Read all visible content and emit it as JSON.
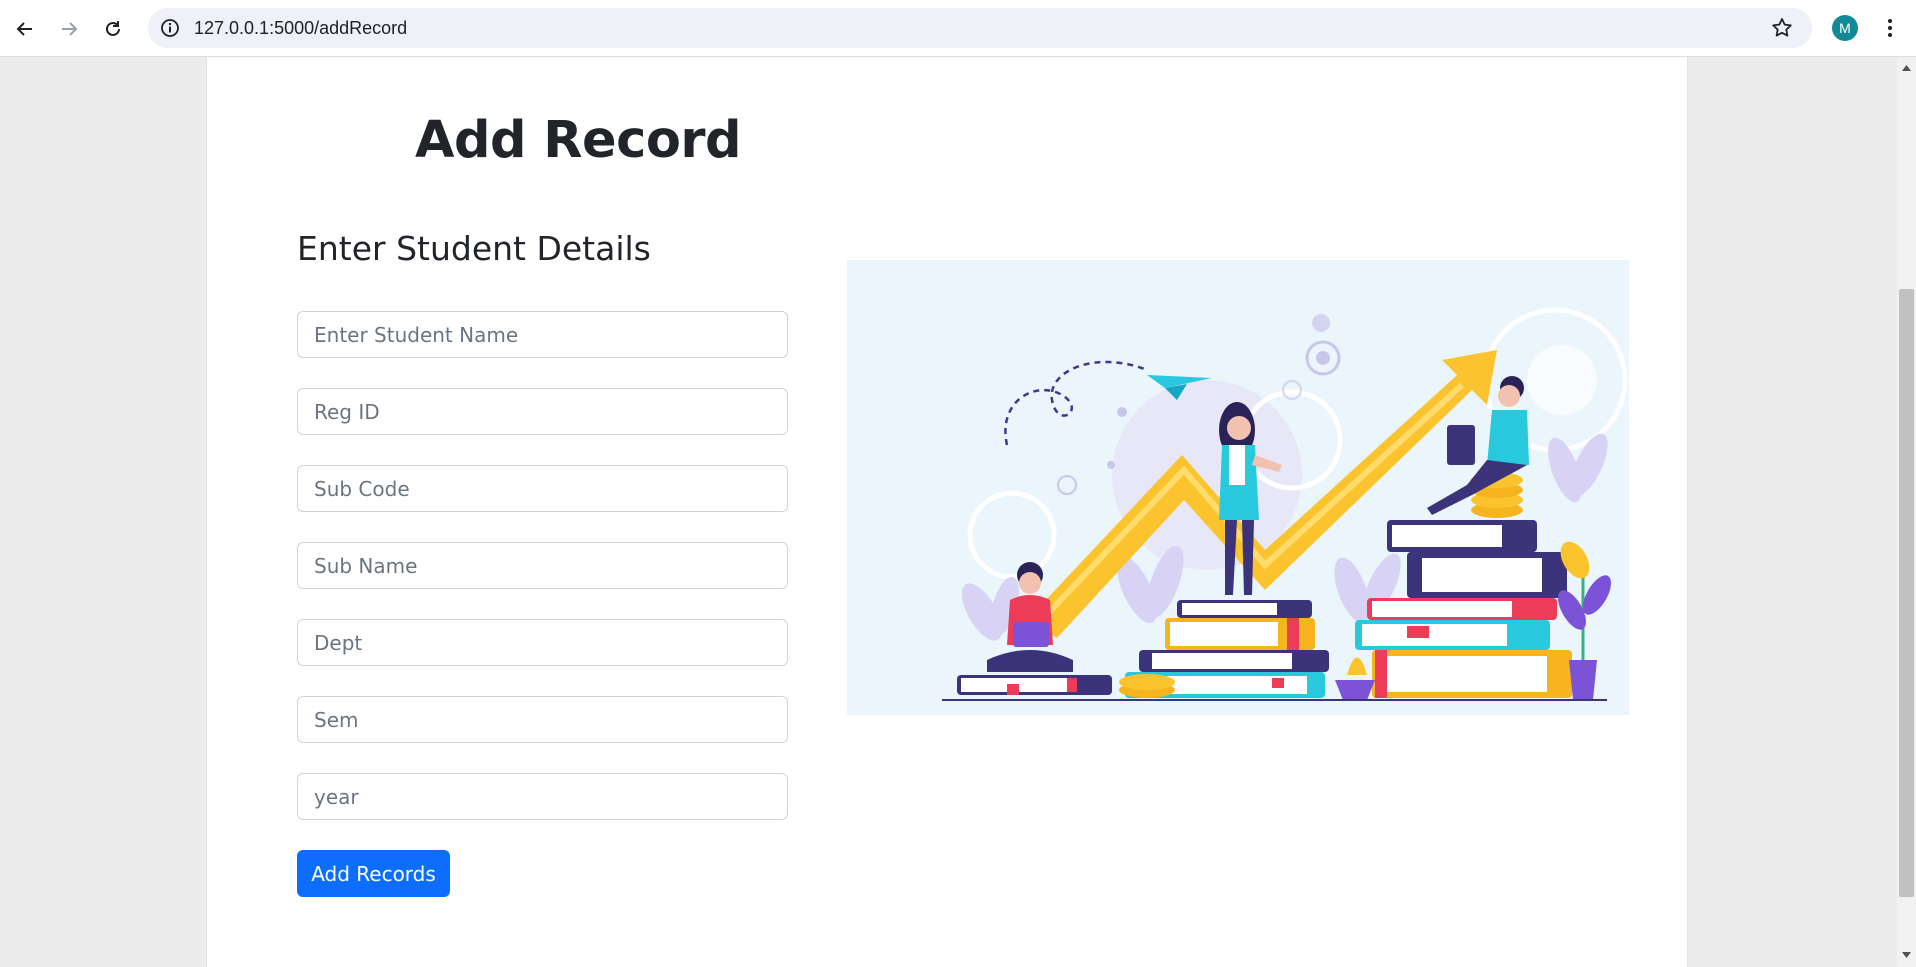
{
  "browser": {
    "url": "127.0.0.1:5000/addRecord",
    "profile_initial": "M",
    "profile_color": "#128a95"
  },
  "page": {
    "title": "Add Record",
    "form_heading": "Enter Student Details",
    "fields": {
      "student_name": {
        "placeholder": "Enter Student Name",
        "value": ""
      },
      "reg_id": {
        "placeholder": "Reg ID",
        "value": ""
      },
      "sub_code": {
        "placeholder": "Sub Code",
        "value": ""
      },
      "sub_name": {
        "placeholder": "Sub Name",
        "value": ""
      },
      "dept": {
        "placeholder": "Dept",
        "value": ""
      },
      "sem": {
        "placeholder": "Sem",
        "value": ""
      },
      "year": {
        "placeholder": "year",
        "value": ""
      }
    },
    "submit_label": "Add Records",
    "accent_color": "#0d6efd"
  }
}
